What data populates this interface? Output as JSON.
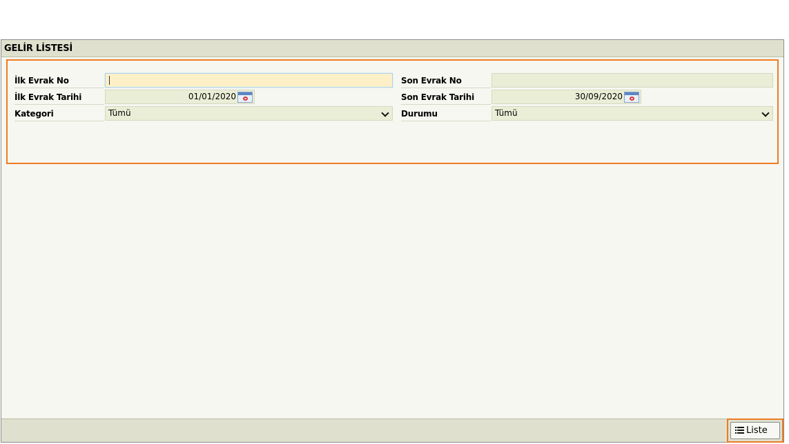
{
  "window": {
    "title": "GELİR LİSTESİ"
  },
  "form": {
    "ilk_evrak_no": {
      "label": "İlk Evrak No",
      "value": ""
    },
    "son_evrak_no": {
      "label": "Son Evrak No",
      "value": ""
    },
    "ilk_evrak_tarihi": {
      "label": "İlk Evrak Tarihi",
      "value": "01/01/2020"
    },
    "son_evrak_tarihi": {
      "label": "Son Evrak Tarihi",
      "value": "30/09/2020"
    },
    "kategori": {
      "label": "Kategori",
      "value": "Tümü"
    },
    "durumu": {
      "label": "Durumu",
      "value": "Tümü"
    }
  },
  "footer": {
    "liste_label": "Liste"
  },
  "colors": {
    "accent": "#ee7a22",
    "field_bg": "#ebeed6",
    "active_field_bg": "#fdf0c8",
    "titlebar_bg": "#dfe1ce"
  },
  "icons": {
    "calendar": "calendar-icon",
    "list": "list-icon",
    "dropdown": "chevron-down-icon"
  }
}
